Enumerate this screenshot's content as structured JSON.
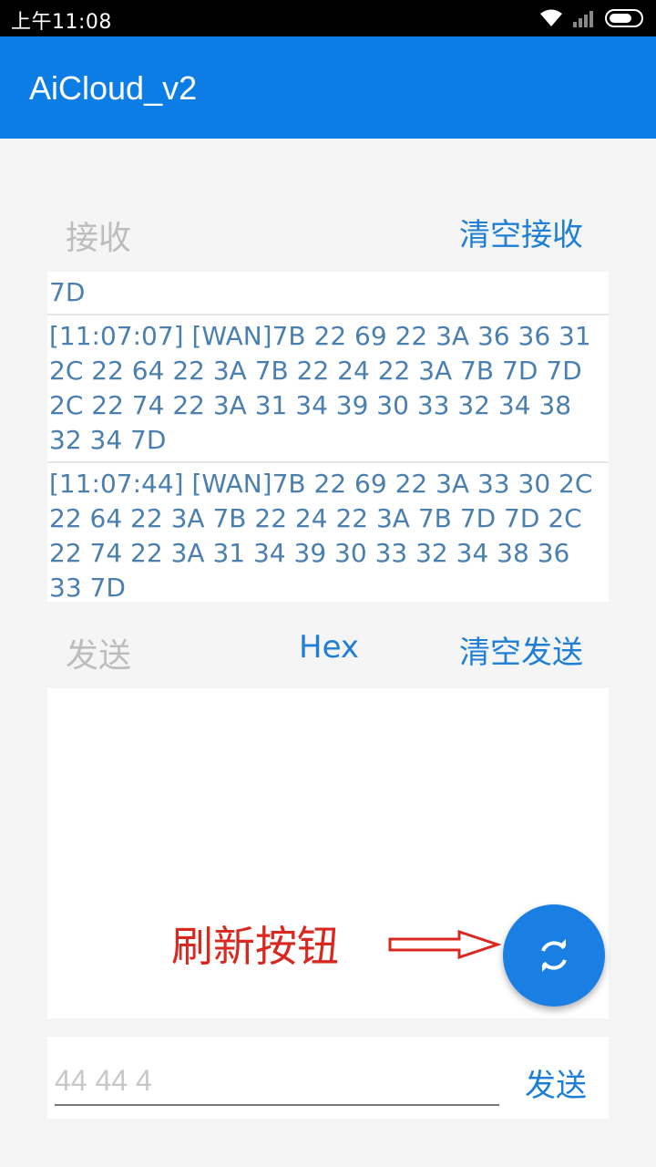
{
  "status_bar": {
    "time": "上午11:08",
    "icons": [
      "wifi-icon",
      "signal-icon",
      "battery-icon"
    ]
  },
  "app_bar": {
    "title": "AiCloud_v2",
    "color": "#0d7de6"
  },
  "receive": {
    "label": "接收",
    "clear_label": "清空接收",
    "lines": [
      "7D",
      "[11:07:07] [WAN]7B 22 69 22 3A 36 36 31 2C 22 64 22 3A 7B 22 24 22 3A 7B 7D 7D 2C 22 74 22 3A 31 34 39 30 33 32 34 38 32 34 7D",
      "[11:07:44] [WAN]7B 22 69 22 3A 33 30 2C 22 64 22 3A 7B 22 24 22 3A 7B 7D 7D 2C 22 74 22 3A 31 34 39 30 33 32 34 38 36 33 7D"
    ]
  },
  "send": {
    "label": "发送",
    "hex_label": "Hex",
    "clear_label": "清空发送"
  },
  "annotation": {
    "text": "刷新按钮",
    "color": "#d8281f"
  },
  "fab": {
    "icon": "refresh-icon"
  },
  "input_row": {
    "placeholder": "44 44 4",
    "send_label": "发送"
  },
  "accent_color": "#1f7fd6"
}
